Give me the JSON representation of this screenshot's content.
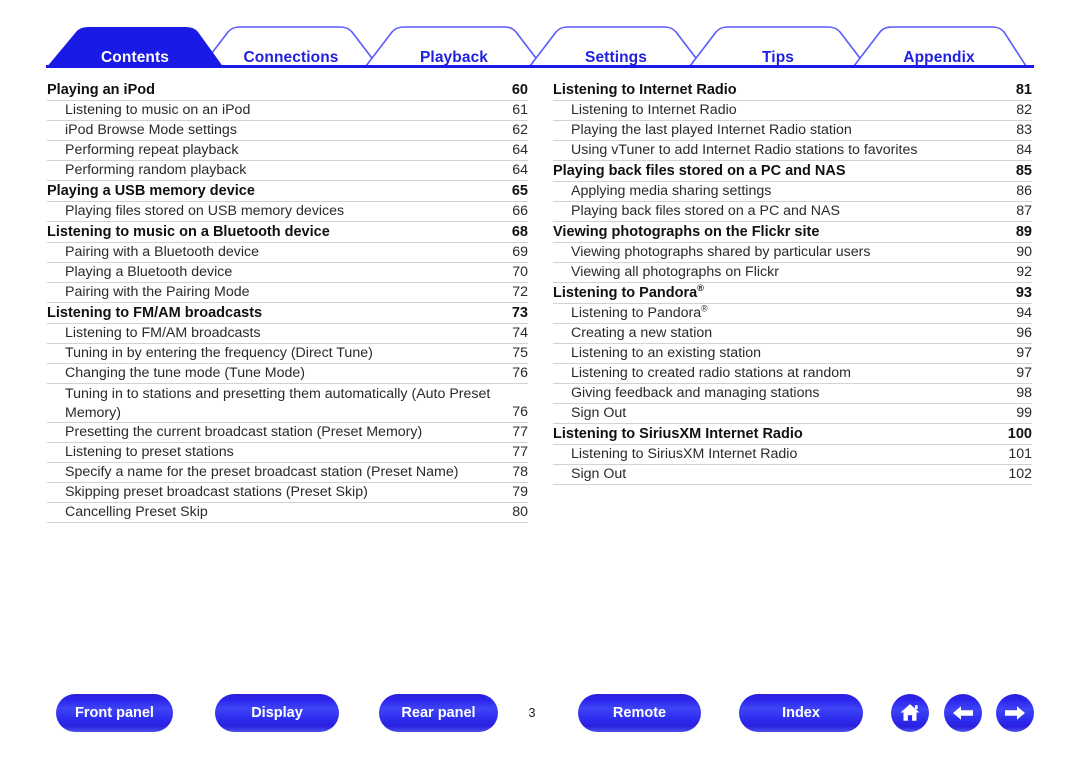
{
  "tabs": [
    {
      "label": "Contents",
      "active": true
    },
    {
      "label": "Connections",
      "active": false
    },
    {
      "label": "Playback",
      "active": false
    },
    {
      "label": "Settings",
      "active": false
    },
    {
      "label": "Tips",
      "active": false
    },
    {
      "label": "Appendix",
      "active": false
    }
  ],
  "colors": {
    "tab_active_fill": "#1a1ae6",
    "tab_text_active": "#ffffff",
    "tab_text_inactive": "#1f1fe0",
    "tab_outline": "#5a5aff",
    "rule": "#1a1ae6",
    "button_blue": "#2b22ec",
    "row_separator": "#d2d2d2"
  },
  "toc": {
    "left_column": [
      {
        "level": 1,
        "title": "Playing an iPod",
        "page": "60"
      },
      {
        "level": 2,
        "title": "Listening to music on an iPod",
        "page": "61"
      },
      {
        "level": 2,
        "title": "iPod Browse Mode settings",
        "page": "62"
      },
      {
        "level": 2,
        "title": "Performing repeat playback",
        "page": "64"
      },
      {
        "level": 2,
        "title": "Performing random playback",
        "page": "64"
      },
      {
        "level": 1,
        "title": "Playing a USB memory device",
        "page": "65"
      },
      {
        "level": 2,
        "title": "Playing files stored on USB memory devices",
        "page": "66"
      },
      {
        "level": 1,
        "title": "Listening to music on a Bluetooth device",
        "page": "68"
      },
      {
        "level": 2,
        "title": "Pairing with a Bluetooth device",
        "page": "69"
      },
      {
        "level": 2,
        "title": "Playing a Bluetooth device",
        "page": "70"
      },
      {
        "level": 2,
        "title": "Pairing with the Pairing Mode",
        "page": "72"
      },
      {
        "level": 1,
        "title": "Listening to FM/AM broadcasts",
        "page": "73"
      },
      {
        "level": 2,
        "title": "Listening to FM/AM broadcasts",
        "page": "74"
      },
      {
        "level": 2,
        "title": "Tuning in by entering the frequency (Direct Tune)",
        "page": "75"
      },
      {
        "level": 2,
        "title": "Changing the tune mode (Tune Mode)",
        "page": "76"
      },
      {
        "level": 2,
        "title": "Tuning in to stations and presetting them automatically (Auto Preset Memory)",
        "page": "76",
        "two_line": true
      },
      {
        "level": 2,
        "title": "Presetting the current broadcast station (Preset Memory)",
        "page": "77"
      },
      {
        "level": 2,
        "title": "Listening to preset stations",
        "page": "77"
      },
      {
        "level": 2,
        "title": "Specify a name for the preset broadcast station (Preset Name)",
        "page": "78"
      },
      {
        "level": 2,
        "title": "Skipping preset broadcast stations (Preset Skip)",
        "page": "79"
      },
      {
        "level": 2,
        "title": "Cancelling Preset Skip",
        "page": "80"
      }
    ],
    "right_column": [
      {
        "level": 1,
        "title": "Listening to Internet Radio",
        "page": "81"
      },
      {
        "level": 2,
        "title": "Listening to Internet Radio",
        "page": "82"
      },
      {
        "level": 2,
        "title": "Playing the last played Internet Radio station",
        "page": "83"
      },
      {
        "level": 2,
        "title": "Using vTuner to add Internet Radio stations to favorites",
        "page": "84"
      },
      {
        "level": 1,
        "title": "Playing back files stored on a PC and NAS",
        "page": "85"
      },
      {
        "level": 2,
        "title": "Applying media sharing settings",
        "page": "86"
      },
      {
        "level": 2,
        "title": "Playing back files stored on a PC and NAS",
        "page": "87"
      },
      {
        "level": 1,
        "title": "Viewing photographs on the Flickr site",
        "page": "89"
      },
      {
        "level": 2,
        "title": "Viewing photographs shared by particular users",
        "page": "90"
      },
      {
        "level": 2,
        "title": "Viewing all photographs on Flickr",
        "page": "92"
      },
      {
        "level": 1,
        "title": "Listening to Pandora",
        "page": "93",
        "registered": true
      },
      {
        "level": 2,
        "title": "Listening to Pandora",
        "page": "94",
        "registered": true
      },
      {
        "level": 2,
        "title": "Creating a new station",
        "page": "96"
      },
      {
        "level": 2,
        "title": "Listening to an existing station",
        "page": "97"
      },
      {
        "level": 2,
        "title": "Listening to created radio stations at random",
        "page": "97"
      },
      {
        "level": 2,
        "title": "Giving feedback and managing stations",
        "page": "98"
      },
      {
        "level": 2,
        "title": "Sign Out",
        "page": "99"
      },
      {
        "level": 1,
        "title": "Listening to SiriusXM Internet Radio",
        "page": "100"
      },
      {
        "level": 2,
        "title": "Listening to SiriusXM Internet Radio",
        "page": "101"
      },
      {
        "level": 2,
        "title": "Sign Out",
        "page": "102"
      }
    ]
  },
  "footer": {
    "buttons": [
      {
        "label": "Front panel",
        "name": "front-panel"
      },
      {
        "label": "Display",
        "name": "display"
      },
      {
        "label": "Rear panel",
        "name": "rear-panel"
      },
      {
        "label": "Remote",
        "name": "remote"
      },
      {
        "label": "Index",
        "name": "index"
      }
    ],
    "page_number": "3",
    "icons": [
      {
        "name": "home-icon"
      },
      {
        "name": "arrow-left-icon"
      },
      {
        "name": "arrow-right-icon"
      }
    ]
  }
}
